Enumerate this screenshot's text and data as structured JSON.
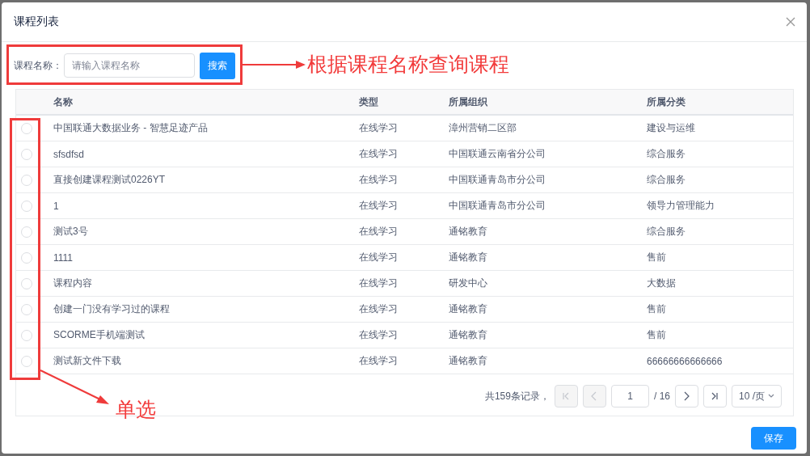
{
  "dialog": {
    "title": "课程列表"
  },
  "search": {
    "label": "课程名称：",
    "placeholder": "请输入课程名称",
    "button": "搜索"
  },
  "table": {
    "columns": [
      "名称",
      "类型",
      "所属组织",
      "所属分类"
    ],
    "rows": [
      {
        "selected": false,
        "cells": [
          "中国联通大数据业务 - 智慧足迹产品",
          "在线学习",
          "漳州营销二区部",
          "建设与运维"
        ]
      },
      {
        "selected": false,
        "cells": [
          "sfsdfsd",
          "在线学习",
          "中国联通云南省分公司",
          "综合服务"
        ]
      },
      {
        "selected": false,
        "cells": [
          "直接创建课程测试0226YT",
          "在线学习",
          "中国联通青岛市分公司",
          "综合服务"
        ]
      },
      {
        "selected": false,
        "cells": [
          "1",
          "在线学习",
          "中国联通青岛市分公司",
          "领导力管理能力"
        ]
      },
      {
        "selected": false,
        "cells": [
          "测试3号",
          "在线学习",
          "通铭教育",
          "综合服务"
        ]
      },
      {
        "selected": false,
        "cells": [
          "1111",
          "在线学习",
          "通铭教育",
          "售前"
        ]
      },
      {
        "selected": false,
        "cells": [
          "课程内容",
          "在线学习",
          "研发中心",
          "大数据"
        ]
      },
      {
        "selected": false,
        "cells": [
          "创建一门没有学习过的课程",
          "在线学习",
          "通铭教育",
          "售前"
        ]
      },
      {
        "selected": false,
        "cells": [
          "SCORME手机端测试",
          "在线学习",
          "通铭教育",
          "售前"
        ]
      },
      {
        "selected": false,
        "cells": [
          "测试新文件下载",
          "在线学习",
          "通铭教育",
          "66666666666666"
        ]
      }
    ]
  },
  "pagination": {
    "summary": "共159条记录，",
    "page": "1",
    "total": "/ 16",
    "page_size": "10 /页",
    "buttons": [
      {
        "kind": "first",
        "disabled": true
      },
      {
        "kind": "prev",
        "disabled": true
      },
      {
        "kind": "next",
        "disabled": false
      },
      {
        "kind": "last",
        "disabled": false
      }
    ]
  },
  "footer": {
    "button": "保存"
  },
  "annotations": [
    {
      "kind": "search",
      "text": "根据课程名称查询课程"
    },
    {
      "kind": "radio",
      "text": "单选"
    }
  ]
}
